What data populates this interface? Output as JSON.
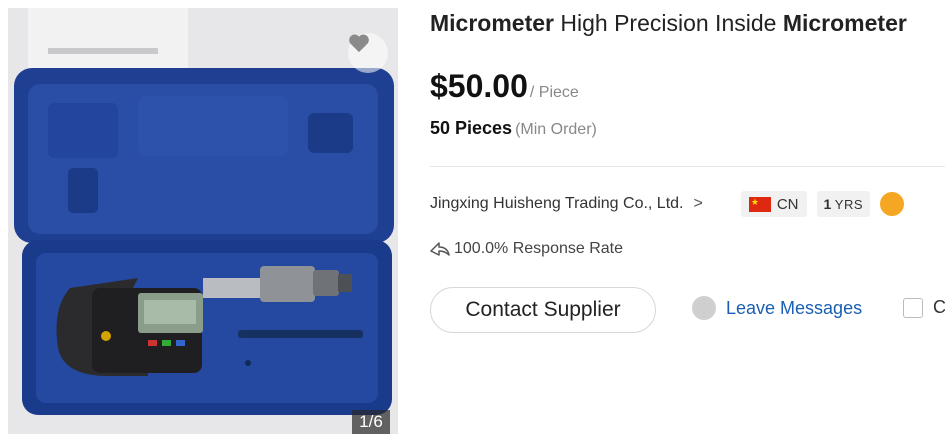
{
  "product": {
    "title_parts": {
      "p1": "Micrometer",
      "p2": " High Precision Inside ",
      "p3": "Micrometer"
    },
    "price": "$50.00",
    "price_unit": "/ Piece",
    "moq_value": "50 Pieces",
    "moq_label": "(Min Order)"
  },
  "gallery": {
    "counter": "1/6",
    "favorite_icon": "heart-icon"
  },
  "supplier": {
    "name": "Jingxing Huisheng Trading Co., Ltd.",
    "chevron": ">",
    "country": "CN",
    "years_num": "1",
    "years_label": "YRS",
    "response_rate": "100.0% Response Rate"
  },
  "actions": {
    "contact": "Contact Supplier",
    "leave_messages": "Leave Messages",
    "compare_initial": "C"
  },
  "colors": {
    "link": "#1a5fb4",
    "case_blue": "#1c3d8f",
    "flag_red": "#de2910",
    "badge_gold": "#f5a623"
  }
}
